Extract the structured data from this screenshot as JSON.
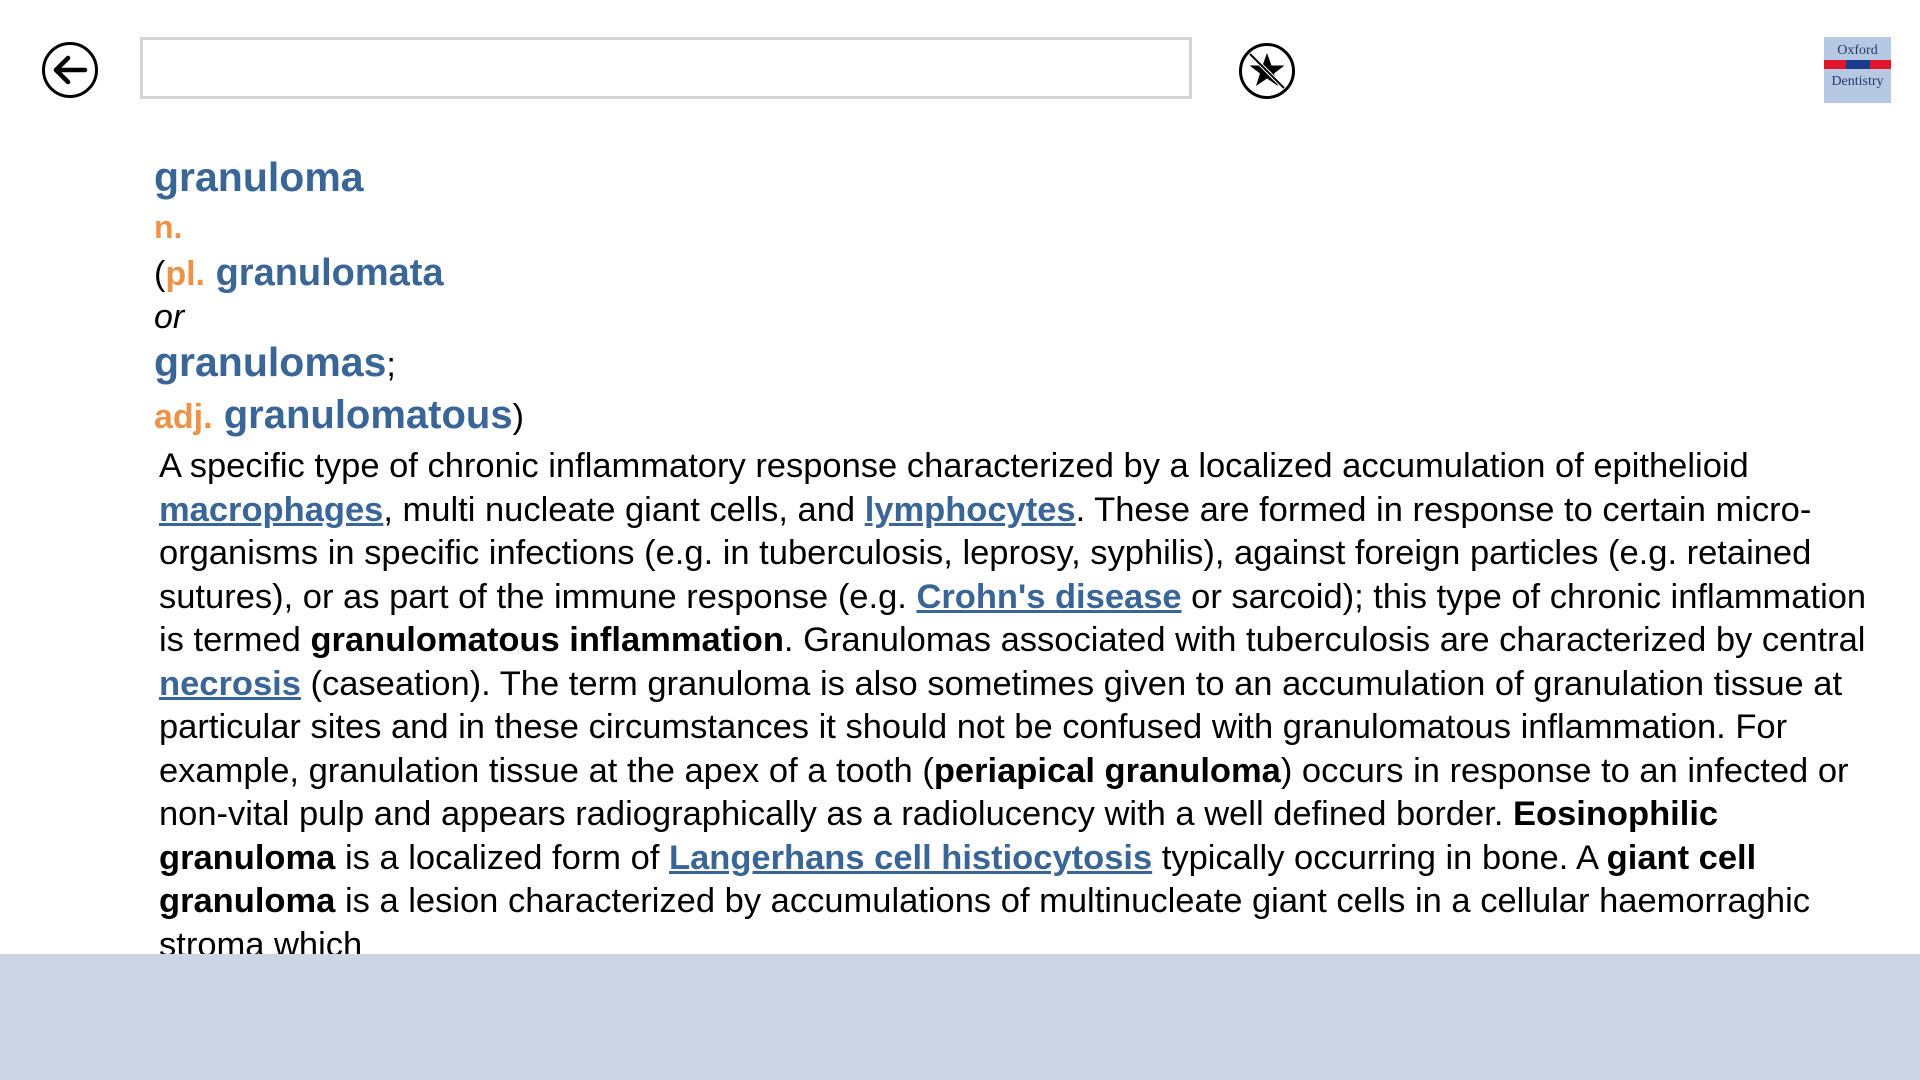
{
  "toolbar": {
    "search_value": "",
    "back_icon": "back-arrow-icon",
    "favorite_icon": "favorite-star-icon"
  },
  "logo": {
    "line1": "Oxford",
    "line2": "Dentistry"
  },
  "entry": {
    "headword": "granuloma",
    "pos": "n.",
    "paren_open": "(",
    "plural_label": "pl.",
    "plural1": "granulomata",
    "or": "or",
    "plural2": "granulomas",
    "semicolon": ";",
    "adj_label": "adj.",
    "adjective": "granulomatous",
    "paren_close": ")"
  },
  "definition": {
    "t1": "A specific type of chronic inflammatory response characterized by a localized accumulation of epithelioid ",
    "link_macrophages": "macrophages",
    "t2": ", multi nucleate giant cells, and ",
    "link_lymphocytes": "lymphocytes",
    "t3": ". These are formed in response to certain micro-organisms in specific infections (e.g. in tuberculosis, leprosy, syphilis), against foreign particles (e.g. retained sutures), or as part of the immune response (e.g. ",
    "link_crohns": "Crohn's disease",
    "t4": " or sarcoid); this type of chronic inflammation is termed ",
    "b_granulomatous_inflammation": "granulomatous inflammation",
    "t5": ". Granulomas associated with tuberculosis are characterized by central ",
    "link_necrosis": "necrosis",
    "t6": " (caseation). The term granuloma is also sometimes given to an accumulation of granulation tissue at particular sites and in these circumstances it should not be confused with granulomatous inflammation. For example, granulation tissue at the apex of a tooth (",
    "b_periapical": "periapical granuloma",
    "t7": ") occurs in response to an infected or non-vital pulp and appears radiographically as a radiolucency with a well defined border. ",
    "b_eosinophilic": "Eosinophilic granuloma",
    "t8": " is a localized form of ",
    "link_langerhans": "Langerhans cell histiocytosis",
    "t9": " typically occurring in bone. A ",
    "b_giant_cell": "giant cell granuloma",
    "t10": " is a lesion characterized by accumulations of multinucleate giant cells in a cellular haemorraghic stroma which"
  },
  "colors": {
    "headword": "#3a6597",
    "part_of_speech": "#ee9248",
    "link": "#3a6597",
    "bottom_bar": "#cbd5e3",
    "logo_bg": "#b7c9e2",
    "logo_red": "#e0162b",
    "logo_blue": "#1a3a8c"
  }
}
